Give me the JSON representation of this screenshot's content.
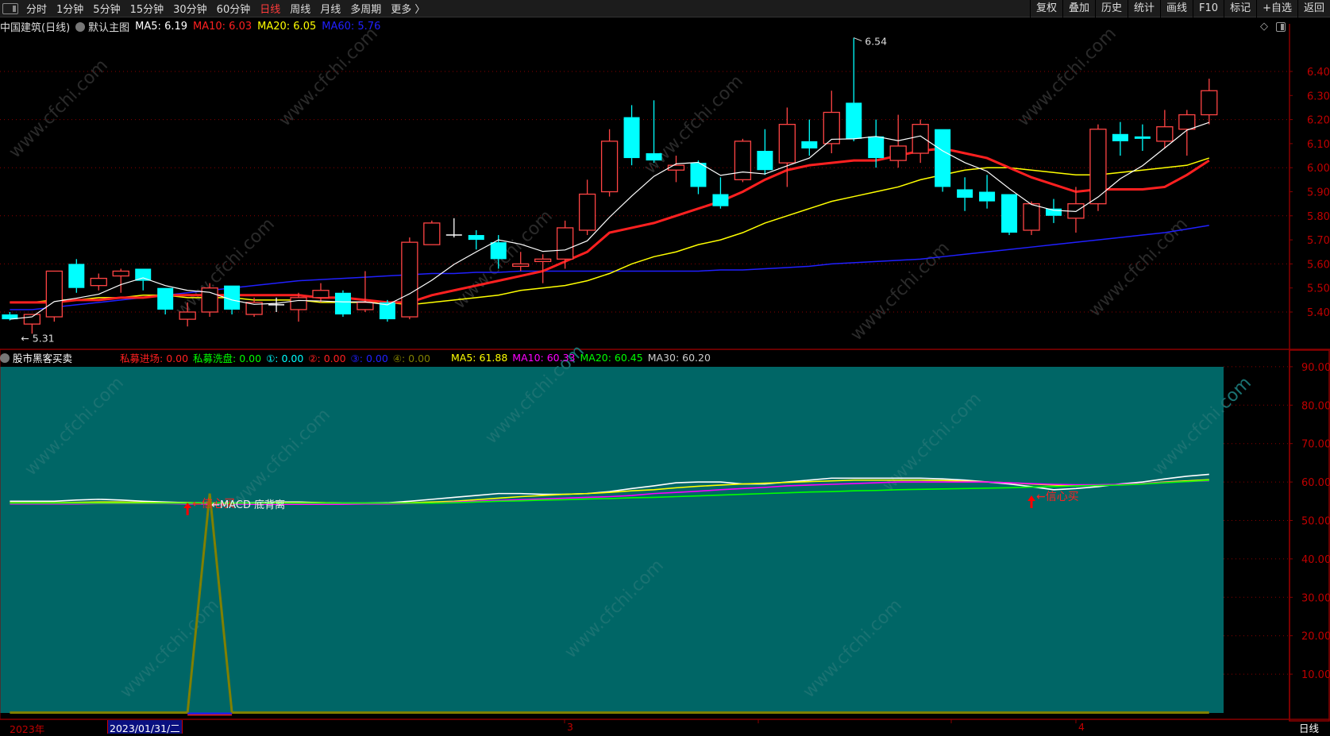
{
  "toolbar": {
    "periods": [
      "分时",
      "1分钟",
      "5分钟",
      "15分钟",
      "30分钟",
      "60分钟",
      "日线",
      "周线",
      "月线",
      "多周期",
      "更多 〉"
    ],
    "active": "日线",
    "right_buttons": [
      "复权",
      "叠加",
      "历史",
      "统计",
      "画线",
      "F10",
      "标记",
      "+自选",
      "返回"
    ]
  },
  "info": {
    "stock": "中国建筑(日线)",
    "template": "默认主图",
    "ma5": "MA5: 6.19",
    "ma10": "MA10: 6.03",
    "ma20": "MA20: 6.05",
    "ma60": "MA60: 5.76"
  },
  "colors": {
    "ma5": "#ffffff",
    "ma10": "#ff2020",
    "ma20": "#ffff00",
    "ma60": "#2020ff",
    "up": "#ff4444",
    "down": "#00ffff",
    "grid": "#8b0000",
    "axis": "#c00000",
    "panel": "#006666"
  },
  "indicator": {
    "name": "股市黑客买卖",
    "items": [
      {
        "label": "私募进场: 0.00",
        "color": "#ff2020"
      },
      {
        "label": "私募洗盘: 0.00",
        "color": "#00ff00"
      },
      {
        "label": "①: 0.00",
        "color": "#00ffff"
      },
      {
        "label": "②: 0.00",
        "color": "#ff2020"
      },
      {
        "label": "③: 0.00",
        "color": "#2020ff"
      },
      {
        "label": "④: 0.00",
        "color": "#808000"
      }
    ],
    "mas": [
      {
        "label": "MA5: 61.88",
        "color": "#ffff00"
      },
      {
        "label": "MA10: 60.33",
        "color": "#ff00ff"
      },
      {
        "label": "MA20: 60.45",
        "color": "#00ff00"
      },
      {
        "label": "MA30: 60.20",
        "color": "#cccccc"
      }
    ],
    "annotations": {
      "buy_signal": "←信心买",
      "macd": "←MACD 底背离"
    }
  },
  "watermark": "www.cfchi.com",
  "bottom": {
    "year": "2023年",
    "cursor_date": "2023/01/31/二",
    "ticks": [
      "3",
      "4"
    ],
    "period": "日线"
  },
  "chart_data": {
    "type": "candlestick",
    "price_axis": {
      "ylim": [
        5.27,
        6.55
      ],
      "ticks": [
        "6.40",
        "6.30",
        "6.20",
        "6.10",
        "6.00",
        "5.90",
        "5.80",
        "5.70",
        "5.60",
        "5.50",
        "5.40"
      ]
    },
    "high_label": "6.54",
    "low_label": "5.31",
    "ohlc": [
      [
        5.39,
        5.4,
        5.365,
        5.37
      ],
      [
        5.35,
        5.39,
        5.31,
        5.39
      ],
      [
        5.38,
        5.57,
        5.36,
        5.57
      ],
      [
        5.6,
        5.62,
        5.48,
        5.5
      ],
      [
        5.51,
        5.56,
        5.49,
        5.54
      ],
      [
        5.55,
        5.58,
        5.48,
        5.57
      ],
      [
        5.58,
        5.58,
        5.49,
        5.53
      ],
      [
        5.5,
        5.5,
        5.39,
        5.41
      ],
      [
        5.37,
        5.44,
        5.34,
        5.4
      ],
      [
        5.4,
        5.52,
        5.38,
        5.5
      ],
      [
        5.51,
        5.51,
        5.39,
        5.41
      ],
      [
        5.39,
        5.46,
        5.38,
        5.44
      ],
      [
        5.43,
        5.46,
        5.4,
        5.43
      ],
      [
        5.41,
        5.48,
        5.36,
        5.46
      ],
      [
        5.46,
        5.52,
        5.44,
        5.49
      ],
      [
        5.48,
        5.49,
        5.38,
        5.39
      ],
      [
        5.41,
        5.57,
        5.4,
        5.44
      ],
      [
        5.44,
        5.45,
        5.36,
        5.37
      ],
      [
        5.38,
        5.71,
        5.37,
        5.69
      ],
      [
        5.68,
        5.78,
        5.68,
        5.77
      ],
      [
        5.72,
        5.79,
        5.71,
        5.72
      ],
      [
        5.72,
        5.74,
        5.66,
        5.7
      ],
      [
        5.69,
        5.72,
        5.58,
        5.62
      ],
      [
        5.59,
        5.65,
        5.57,
        5.6
      ],
      [
        5.61,
        5.64,
        5.52,
        5.62
      ],
      [
        5.62,
        5.78,
        5.58,
        5.75
      ],
      [
        5.74,
        5.95,
        5.72,
        5.89
      ],
      [
        5.9,
        6.16,
        5.88,
        6.11
      ],
      [
        6.21,
        6.26,
        6.01,
        6.04
      ],
      [
        6.06,
        6.28,
        6.02,
        6.03
      ],
      [
        5.99,
        6.05,
        5.94,
        6.01
      ],
      [
        6.02,
        6.03,
        5.89,
        5.92
      ],
      [
        5.89,
        5.96,
        5.83,
        5.84
      ],
      [
        5.95,
        6.12,
        5.94,
        6.11
      ],
      [
        6.07,
        6.16,
        5.97,
        5.99
      ],
      [
        6.02,
        6.25,
        5.92,
        6.18
      ],
      [
        6.11,
        6.2,
        6.05,
        6.08
      ],
      [
        6.1,
        6.32,
        6.06,
        6.23
      ],
      [
        6.27,
        6.54,
        6.11,
        6.12
      ],
      [
        6.13,
        6.2,
        6.0,
        6.04
      ],
      [
        6.03,
        6.22,
        6.0,
        6.09
      ],
      [
        6.06,
        6.2,
        6.02,
        6.18
      ],
      [
        6.16,
        6.16,
        5.9,
        5.92
      ],
      [
        5.91,
        5.96,
        5.82,
        5.875
      ],
      [
        5.9,
        5.97,
        5.83,
        5.86
      ],
      [
        5.89,
        5.89,
        5.72,
        5.73
      ],
      [
        5.74,
        5.86,
        5.72,
        5.85
      ],
      [
        5.83,
        5.87,
        5.77,
        5.8
      ],
      [
        5.79,
        5.92,
        5.73,
        5.85
      ],
      [
        5.85,
        6.18,
        5.82,
        6.16
      ],
      [
        6.14,
        6.19,
        6.05,
        6.11
      ],
      [
        6.13,
        6.18,
        6.07,
        6.12
      ],
      [
        6.11,
        6.24,
        6.08,
        6.17
      ],
      [
        6.16,
        6.24,
        6.05,
        6.22
      ],
      [
        6.22,
        6.37,
        6.18,
        6.32
      ]
    ],
    "ma10": [
      5.44,
      5.44,
      5.44,
      5.45,
      5.45,
      5.46,
      5.46,
      5.47,
      5.47,
      5.47,
      5.47,
      5.47,
      5.47,
      5.47,
      5.46,
      5.46,
      5.45,
      5.44,
      5.44,
      5.47,
      5.49,
      5.51,
      5.53,
      5.55,
      5.57,
      5.61,
      5.65,
      5.73,
      5.75,
      5.77,
      5.8,
      5.83,
      5.86,
      5.9,
      5.95,
      5.99,
      6.01,
      6.02,
      6.03,
      6.03,
      6.05,
      6.07,
      6.08,
      6.06,
      6.04,
      6.0,
      5.96,
      5.93,
      5.9,
      5.91,
      5.91,
      5.91,
      5.92,
      5.97,
      6.03
    ],
    "ma20": [
      5.44,
      5.44,
      5.45,
      5.45,
      5.46,
      5.46,
      5.47,
      5.47,
      5.46,
      5.46,
      5.46,
      5.45,
      5.45,
      5.45,
      5.44,
      5.44,
      5.44,
      5.44,
      5.43,
      5.44,
      5.45,
      5.46,
      5.47,
      5.49,
      5.5,
      5.51,
      5.53,
      5.56,
      5.6,
      5.63,
      5.65,
      5.68,
      5.7,
      5.73,
      5.77,
      5.8,
      5.83,
      5.86,
      5.88,
      5.9,
      5.92,
      5.95,
      5.97,
      5.99,
      6.0,
      6.0,
      5.99,
      5.98,
      5.97,
      5.97,
      5.98,
      5.99,
      6.0,
      6.01,
      6.04
    ],
    "ma60": [
      5.41,
      5.41,
      5.42,
      5.43,
      5.44,
      5.45,
      5.46,
      5.47,
      5.48,
      5.49,
      5.5,
      5.51,
      5.52,
      5.53,
      5.535,
      5.54,
      5.545,
      5.55,
      5.555,
      5.56,
      5.56,
      5.565,
      5.565,
      5.57,
      5.57,
      5.57,
      5.57,
      5.57,
      5.57,
      5.57,
      5.57,
      5.57,
      5.575,
      5.575,
      5.58,
      5.585,
      5.59,
      5.6,
      5.605,
      5.61,
      5.615,
      5.62,
      5.63,
      5.64,
      5.65,
      5.66,
      5.67,
      5.68,
      5.69,
      5.7,
      5.71,
      5.72,
      5.73,
      5.745,
      5.76
    ],
    "indicator_axis": {
      "ylim": [
        0,
        90
      ],
      "ticks": [
        "90.00",
        "80.00",
        "70.00",
        "60.00",
        "50.00",
        "40.00",
        "30.00",
        "20.00",
        "10.00"
      ]
    },
    "indicator_series": [
      {
        "color": "#ffffff",
        "values": [
          55,
          55,
          55,
          55.3,
          55.5,
          55.3,
          55,
          54.8,
          54.6,
          54.5,
          54.5,
          54.6,
          54.8,
          54.8,
          54.6,
          54.5,
          54.5,
          54.6,
          55,
          55.5,
          56,
          56.5,
          57,
          57,
          56.8,
          56.8,
          57,
          57.5,
          58.3,
          59,
          59.8,
          60,
          60,
          59.5,
          59.5,
          60,
          60.5,
          61,
          61,
          61,
          61,
          61,
          60.8,
          60.5,
          60,
          59.5,
          58.8,
          58,
          58.3,
          58.8,
          59.5,
          60,
          60.8,
          61.5,
          62
        ]
      },
      {
        "color": "#ffff00",
        "values": [
          54.6,
          54.6,
          54.6,
          54.7,
          54.8,
          54.8,
          54.7,
          54.6,
          54.6,
          54.5,
          54.5,
          54.5,
          54.6,
          54.6,
          54.6,
          54.5,
          54.5,
          54.5,
          54.6,
          54.8,
          55,
          55.4,
          55.8,
          56.2,
          56.5,
          56.8,
          57,
          57.3,
          57.7,
          58,
          58.5,
          58.9,
          59.2,
          59.5,
          59.7,
          59.9,
          60.1,
          60.3,
          60.5,
          60.5,
          60.5,
          60.5,
          60.4,
          60.2,
          60,
          59.8,
          59.5,
          59.2,
          59,
          59.1,
          59.3,
          59.6,
          60,
          60.3,
          60.6
        ]
      },
      {
        "color": "#ff00ff",
        "values": [
          54.3,
          54.3,
          54.3,
          54.3,
          54.4,
          54.4,
          54.4,
          54.4,
          54.3,
          54.3,
          54.3,
          54.2,
          54.2,
          54.2,
          54.2,
          54.2,
          54.3,
          54.3,
          54.4,
          54.5,
          54.8,
          55,
          55.2,
          55.4,
          55.6,
          55.8,
          56,
          56.2,
          56.5,
          57,
          57.3,
          57.6,
          58,
          58.3,
          58.6,
          59,
          59.2,
          59.4,
          59.6,
          59.8,
          60,
          60,
          60,
          60,
          60,
          59.8,
          59.6,
          59.4,
          59.3,
          59.3,
          59.4,
          59.6,
          59.9,
          60.1,
          60.33
        ]
      },
      {
        "color": "#00ff00",
        "values": [
          54.5,
          54.5,
          54.5,
          54.5,
          54.5,
          54.5,
          54.5,
          54.5,
          54.5,
          54.5,
          54.5,
          54.5,
          54.5,
          54.5,
          54.5,
          54.5,
          54.5,
          54.5,
          54.5,
          54.5,
          54.6,
          54.8,
          55,
          55.1,
          55.3,
          55.4,
          55.6,
          55.7,
          55.9,
          56,
          56.2,
          56.4,
          56.6,
          56.8,
          57,
          57.2,
          57.4,
          57.5,
          57.7,
          57.8,
          58,
          58.1,
          58.2,
          58.3,
          58.4,
          58.5,
          58.7,
          58.8,
          59,
          59.1,
          59.2,
          59.5,
          59.8,
          60.1,
          60.45
        ]
      },
      {
        "color": "#808000",
        "values": [
          0,
          0,
          0,
          0,
          0,
          0,
          0,
          0,
          0,
          57,
          0,
          0,
          0,
          0,
          0,
          0,
          0,
          0,
          0,
          0,
          0,
          0,
          0,
          0,
          0,
          0,
          0,
          0,
          0,
          0,
          0,
          0,
          0,
          0,
          0,
          0,
          0,
          0,
          0,
          0,
          0,
          0,
          0,
          0,
          0,
          0,
          0,
          0,
          0,
          0,
          0,
          0,
          0,
          0,
          0
        ]
      }
    ],
    "signals": [
      {
        "candle": 9,
        "type": "buy_signal"
      },
      {
        "candle": 47,
        "type": "buy_signal"
      },
      {
        "candle": 10,
        "type": "macd"
      }
    ]
  }
}
